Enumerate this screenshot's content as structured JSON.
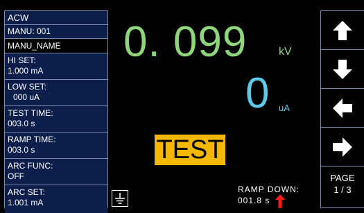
{
  "sidebar": {
    "mode": "ACW",
    "manu": "MANU: 001",
    "manu_name": "MANU_NAME",
    "items": [
      {
        "label": "HI SET:",
        "value": "1.000 mA"
      },
      {
        "label": "LOW SET:",
        "value": "000 uA"
      },
      {
        "label": "TEST TIME:",
        "value": "003.0 s"
      },
      {
        "label": "RAMP TIME:",
        "value": "003.0 s"
      },
      {
        "label": "ARC FUNC:",
        "value": "OFF"
      },
      {
        "label": "ARC SET:",
        "value": "1.001 mA"
      }
    ]
  },
  "readout": {
    "voltage": "0. 099",
    "voltage_unit": "kV",
    "current": "0",
    "current_unit": "uA"
  },
  "status": {
    "test_label": "TEST",
    "phase_label": "RAMP DOWN:",
    "phase_time": "001.8 s"
  },
  "nav": {
    "buttons": [
      "arrow-up-icon",
      "arrow-down-icon",
      "arrow-left-icon",
      "arrow-right-icon"
    ],
    "page_label": "PAGE",
    "page_value": "1 / 3"
  },
  "colors": {
    "voltage": "#8ed67a",
    "current": "#5cc8ea",
    "test_badge": "#f5b800",
    "panel": "#0c1f4a",
    "ramp_arrow": "#ff1a1a"
  }
}
